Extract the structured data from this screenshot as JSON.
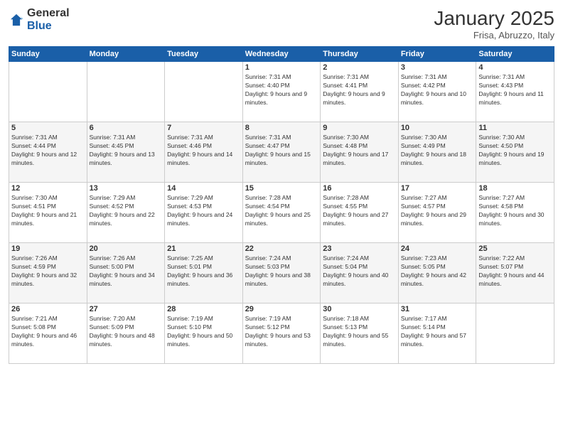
{
  "logo": {
    "general": "General",
    "blue": "Blue"
  },
  "header": {
    "title": "January 2025",
    "subtitle": "Frisa, Abruzzo, Italy"
  },
  "weekdays": [
    "Sunday",
    "Monday",
    "Tuesday",
    "Wednesday",
    "Thursday",
    "Friday",
    "Saturday"
  ],
  "weeks": [
    [
      {
        "day": "",
        "sunrise": "",
        "sunset": "",
        "daylight": ""
      },
      {
        "day": "",
        "sunrise": "",
        "sunset": "",
        "daylight": ""
      },
      {
        "day": "",
        "sunrise": "",
        "sunset": "",
        "daylight": ""
      },
      {
        "day": "1",
        "sunrise": "Sunrise: 7:31 AM",
        "sunset": "Sunset: 4:40 PM",
        "daylight": "Daylight: 9 hours and 9 minutes."
      },
      {
        "day": "2",
        "sunrise": "Sunrise: 7:31 AM",
        "sunset": "Sunset: 4:41 PM",
        "daylight": "Daylight: 9 hours and 9 minutes."
      },
      {
        "day": "3",
        "sunrise": "Sunrise: 7:31 AM",
        "sunset": "Sunset: 4:42 PM",
        "daylight": "Daylight: 9 hours and 10 minutes."
      },
      {
        "day": "4",
        "sunrise": "Sunrise: 7:31 AM",
        "sunset": "Sunset: 4:43 PM",
        "daylight": "Daylight: 9 hours and 11 minutes."
      }
    ],
    [
      {
        "day": "5",
        "sunrise": "Sunrise: 7:31 AM",
        "sunset": "Sunset: 4:44 PM",
        "daylight": "Daylight: 9 hours and 12 minutes."
      },
      {
        "day": "6",
        "sunrise": "Sunrise: 7:31 AM",
        "sunset": "Sunset: 4:45 PM",
        "daylight": "Daylight: 9 hours and 13 minutes."
      },
      {
        "day": "7",
        "sunrise": "Sunrise: 7:31 AM",
        "sunset": "Sunset: 4:46 PM",
        "daylight": "Daylight: 9 hours and 14 minutes."
      },
      {
        "day": "8",
        "sunrise": "Sunrise: 7:31 AM",
        "sunset": "Sunset: 4:47 PM",
        "daylight": "Daylight: 9 hours and 15 minutes."
      },
      {
        "day": "9",
        "sunrise": "Sunrise: 7:30 AM",
        "sunset": "Sunset: 4:48 PM",
        "daylight": "Daylight: 9 hours and 17 minutes."
      },
      {
        "day": "10",
        "sunrise": "Sunrise: 7:30 AM",
        "sunset": "Sunset: 4:49 PM",
        "daylight": "Daylight: 9 hours and 18 minutes."
      },
      {
        "day": "11",
        "sunrise": "Sunrise: 7:30 AM",
        "sunset": "Sunset: 4:50 PM",
        "daylight": "Daylight: 9 hours and 19 minutes."
      }
    ],
    [
      {
        "day": "12",
        "sunrise": "Sunrise: 7:30 AM",
        "sunset": "Sunset: 4:51 PM",
        "daylight": "Daylight: 9 hours and 21 minutes."
      },
      {
        "day": "13",
        "sunrise": "Sunrise: 7:29 AM",
        "sunset": "Sunset: 4:52 PM",
        "daylight": "Daylight: 9 hours and 22 minutes."
      },
      {
        "day": "14",
        "sunrise": "Sunrise: 7:29 AM",
        "sunset": "Sunset: 4:53 PM",
        "daylight": "Daylight: 9 hours and 24 minutes."
      },
      {
        "day": "15",
        "sunrise": "Sunrise: 7:28 AM",
        "sunset": "Sunset: 4:54 PM",
        "daylight": "Daylight: 9 hours and 25 minutes."
      },
      {
        "day": "16",
        "sunrise": "Sunrise: 7:28 AM",
        "sunset": "Sunset: 4:55 PM",
        "daylight": "Daylight: 9 hours and 27 minutes."
      },
      {
        "day": "17",
        "sunrise": "Sunrise: 7:27 AM",
        "sunset": "Sunset: 4:57 PM",
        "daylight": "Daylight: 9 hours and 29 minutes."
      },
      {
        "day": "18",
        "sunrise": "Sunrise: 7:27 AM",
        "sunset": "Sunset: 4:58 PM",
        "daylight": "Daylight: 9 hours and 30 minutes."
      }
    ],
    [
      {
        "day": "19",
        "sunrise": "Sunrise: 7:26 AM",
        "sunset": "Sunset: 4:59 PM",
        "daylight": "Daylight: 9 hours and 32 minutes."
      },
      {
        "day": "20",
        "sunrise": "Sunrise: 7:26 AM",
        "sunset": "Sunset: 5:00 PM",
        "daylight": "Daylight: 9 hours and 34 minutes."
      },
      {
        "day": "21",
        "sunrise": "Sunrise: 7:25 AM",
        "sunset": "Sunset: 5:01 PM",
        "daylight": "Daylight: 9 hours and 36 minutes."
      },
      {
        "day": "22",
        "sunrise": "Sunrise: 7:24 AM",
        "sunset": "Sunset: 5:03 PM",
        "daylight": "Daylight: 9 hours and 38 minutes."
      },
      {
        "day": "23",
        "sunrise": "Sunrise: 7:24 AM",
        "sunset": "Sunset: 5:04 PM",
        "daylight": "Daylight: 9 hours and 40 minutes."
      },
      {
        "day": "24",
        "sunrise": "Sunrise: 7:23 AM",
        "sunset": "Sunset: 5:05 PM",
        "daylight": "Daylight: 9 hours and 42 minutes."
      },
      {
        "day": "25",
        "sunrise": "Sunrise: 7:22 AM",
        "sunset": "Sunset: 5:07 PM",
        "daylight": "Daylight: 9 hours and 44 minutes."
      }
    ],
    [
      {
        "day": "26",
        "sunrise": "Sunrise: 7:21 AM",
        "sunset": "Sunset: 5:08 PM",
        "daylight": "Daylight: 9 hours and 46 minutes."
      },
      {
        "day": "27",
        "sunrise": "Sunrise: 7:20 AM",
        "sunset": "Sunset: 5:09 PM",
        "daylight": "Daylight: 9 hours and 48 minutes."
      },
      {
        "day": "28",
        "sunrise": "Sunrise: 7:19 AM",
        "sunset": "Sunset: 5:10 PM",
        "daylight": "Daylight: 9 hours and 50 minutes."
      },
      {
        "day": "29",
        "sunrise": "Sunrise: 7:19 AM",
        "sunset": "Sunset: 5:12 PM",
        "daylight": "Daylight: 9 hours and 53 minutes."
      },
      {
        "day": "30",
        "sunrise": "Sunrise: 7:18 AM",
        "sunset": "Sunset: 5:13 PM",
        "daylight": "Daylight: 9 hours and 55 minutes."
      },
      {
        "day": "31",
        "sunrise": "Sunrise: 7:17 AM",
        "sunset": "Sunset: 5:14 PM",
        "daylight": "Daylight: 9 hours and 57 minutes."
      },
      {
        "day": "",
        "sunrise": "",
        "sunset": "",
        "daylight": ""
      }
    ]
  ]
}
